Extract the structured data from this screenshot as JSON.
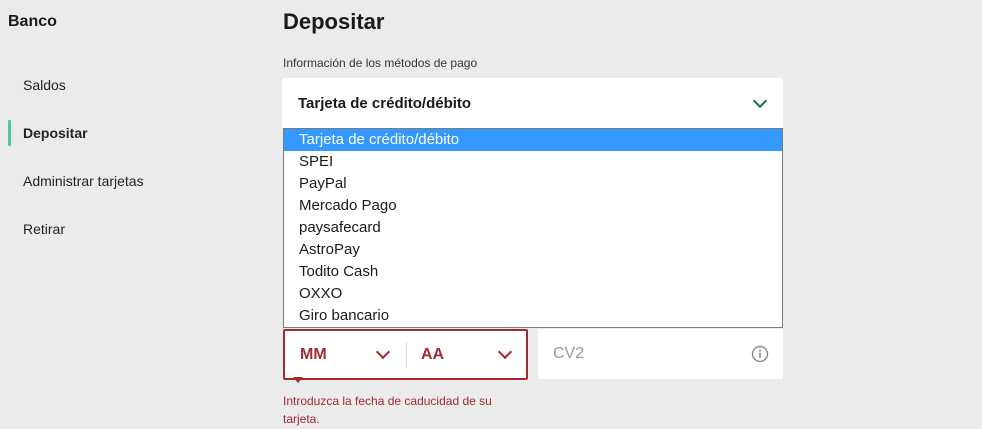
{
  "sidebar": {
    "title": "Banco",
    "items": [
      {
        "label": "Saldos",
        "active": false
      },
      {
        "label": "Depositar",
        "active": true
      },
      {
        "label": "Administrar tarjetas",
        "active": false
      },
      {
        "label": "Retirar",
        "active": false
      }
    ]
  },
  "main": {
    "title": "Depositar",
    "payment_section_label": "Información de los métodos de pago",
    "payment_select": {
      "value": "Tarjeta de crédito/débito",
      "options": [
        "Tarjeta de crédito/débito",
        "SPEI",
        "PayPal",
        "Mercado Pago",
        "paysafecard",
        "AstroPay",
        "Todito Cash",
        "OXXO",
        "Giro bancario"
      ],
      "highlighted_option": "Tarjeta de crédito/débito"
    },
    "expiry": {
      "month_placeholder": "MM",
      "year_placeholder": "AA",
      "error": "Introduzca la fecha de caducidad de su tarjeta."
    },
    "cv2": {
      "placeholder": "CV2",
      "icon": "info-icon"
    }
  },
  "colors": {
    "background": "#ebebeb",
    "accent_green": "#4ec99a",
    "chevron_green": "#1e6b55",
    "error_red": "#a02b30",
    "selection_blue": "#3399ff"
  }
}
